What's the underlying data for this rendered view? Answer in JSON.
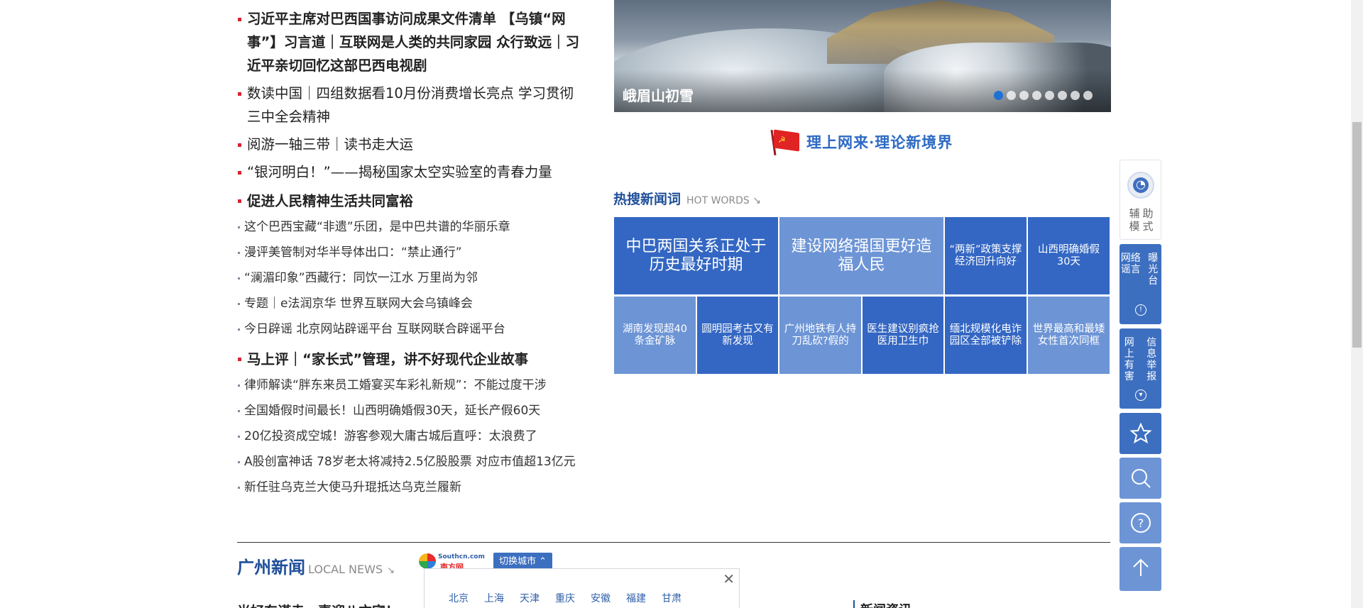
{
  "left": {
    "headline_main": "习近平主席对巴西国事访问成果文件清单 【乌镇“网事”】习言道｜互联网是人类的共同家园 众行致远｜习近平亲切回忆这部巴西电视剧",
    "headlines": [
      "数读中国｜四组数据看10月份消费增长亮点  学习贯彻三中全会精神",
      "阅游一轴三带｜读书走大运",
      "“银河明白！”——揭秘国家太空实验室的青春力量"
    ],
    "section1": {
      "title": "促进人民精神生活共同富裕",
      "items": [
        "这个巴西宝藏“非遗”乐团，是中巴共谱的华丽乐章",
        "漫评美管制对华半导体出口：“禁止通行”",
        "“澜湄印象”西藏行：同饮一江水 万里尚为邻",
        "专题｜e法润京华 世界互联网大会乌镇峰会",
        "今日辟谣 北京网站辟谣平台 互联网联合辟谣平台"
      ]
    },
    "section2": {
      "title": "马上评｜“家长式”管理，讲不好现代企业故事",
      "items": [
        "律师解读“胖东来员工婚宴买车彩礼新规”：不能过度干涉",
        "全国婚假时间最长！山西明确婚假30天，延长产假60天",
        "20亿投资成空城！游客参观大庸古城后直呼：太浪费了",
        "A股创富神话 78岁老太将减持2.5亿股股票 对应市值超13亿元",
        "新任驻乌克兰大使马升琨抵达乌克兰履新"
      ]
    }
  },
  "banner": {
    "caption": "峨眉山初雪",
    "slides": 8,
    "active_slide": 1
  },
  "theory": {
    "text": "理上网来·理论新境界"
  },
  "hot_words": {
    "title": "热搜新闻词",
    "title_en": "HOT WORDS ↘",
    "tiles": [
      "中巴两国关系正处于历史最好时期",
      "建设网络强国更好造福人民",
      "“两新”政策支撑经济回升向好",
      "山西明确婚假30天",
      "湖南发现超40条金矿脉",
      "圆明园考古又有新发现",
      "广州地铁有人持刀乱砍?假的",
      "医生建议别疯抢医用卫生巾",
      "缅北规模化电诈园区全部被铲除",
      "世界最高和最矮女性首次同框"
    ]
  },
  "tools": {
    "assist_label": "辅助模式",
    "rumor_col1": "网络谣言",
    "rumor_col2": "曝光台",
    "harm_col1": "网上有害",
    "harm_col2": "信息举报"
  },
  "bottom": {
    "local_title": "广州新闻",
    "local_title_en": "LOCAL NEWS",
    "local_arrow": "↘",
    "southcn_top": "Southcn.com",
    "southcn_bottom": "南方网",
    "switch_city": "切换城市 ⌃",
    "popup_close": "✕",
    "cities": [
      "北京",
      "上海",
      "天津",
      "重庆",
      "安徽",
      "福建",
      "甘肃"
    ],
    "peek_headline": "光好东谨走，喜迎八方宾！",
    "peek_news_info": "新闻资讯"
  }
}
